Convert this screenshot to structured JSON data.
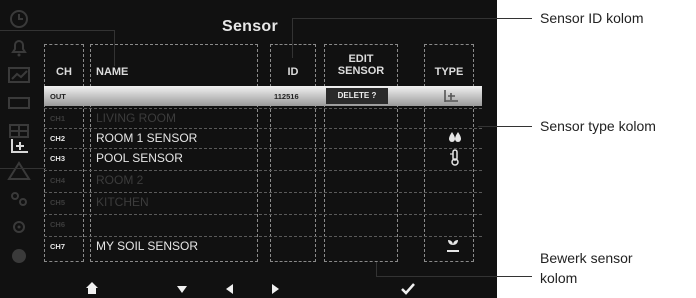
{
  "screen": {
    "title": "Sensor",
    "headers": {
      "ch": "CH",
      "name": "NAME",
      "id": "ID",
      "edit_line1": "EDIT",
      "edit_line2": "SENSOR",
      "type": "TYPE"
    },
    "rows": [
      {
        "ch": "OUT",
        "name": "",
        "id": "112516",
        "edit": "DELETE ?",
        "type_icon": "sensor-small-icon",
        "selected": true
      },
      {
        "ch": "CH1",
        "name": "LIVING ROOM",
        "id": "",
        "edit": "",
        "type_icon": "",
        "dim": true
      },
      {
        "ch": "CH2",
        "name": "ROOM 1 SENSOR",
        "id": "",
        "edit": "",
        "type_icon": "humidity-drops-icon"
      },
      {
        "ch": "CH3",
        "name": "POOL SENSOR",
        "id": "",
        "edit": "",
        "type_icon": "thermometer-icon"
      },
      {
        "ch": "CH4",
        "name": "ROOM 2",
        "id": "",
        "edit": "",
        "type_icon": "",
        "dim": true
      },
      {
        "ch": "CH5",
        "name": "KITCHEN",
        "id": "",
        "edit": "",
        "type_icon": "",
        "dim": true
      },
      {
        "ch": "CH6",
        "name": "",
        "id": "",
        "edit": "",
        "type_icon": "",
        "dim": true
      },
      {
        "ch": "CH7",
        "name": "MY SOIL SENSOR",
        "id": "",
        "edit": "",
        "type_icon": "soil-plant-icon"
      }
    ],
    "bottom_nav": [
      "home-icon",
      "down-arrow-icon",
      "left-arrow-icon",
      "right-arrow-icon",
      "check-icon"
    ]
  },
  "callouts": {
    "sensor_id": "Sensor ID kolom",
    "sensor_type": "Sensor type kolom",
    "edit_line1": "Bewerk sensor",
    "edit_line2": "kolom"
  }
}
